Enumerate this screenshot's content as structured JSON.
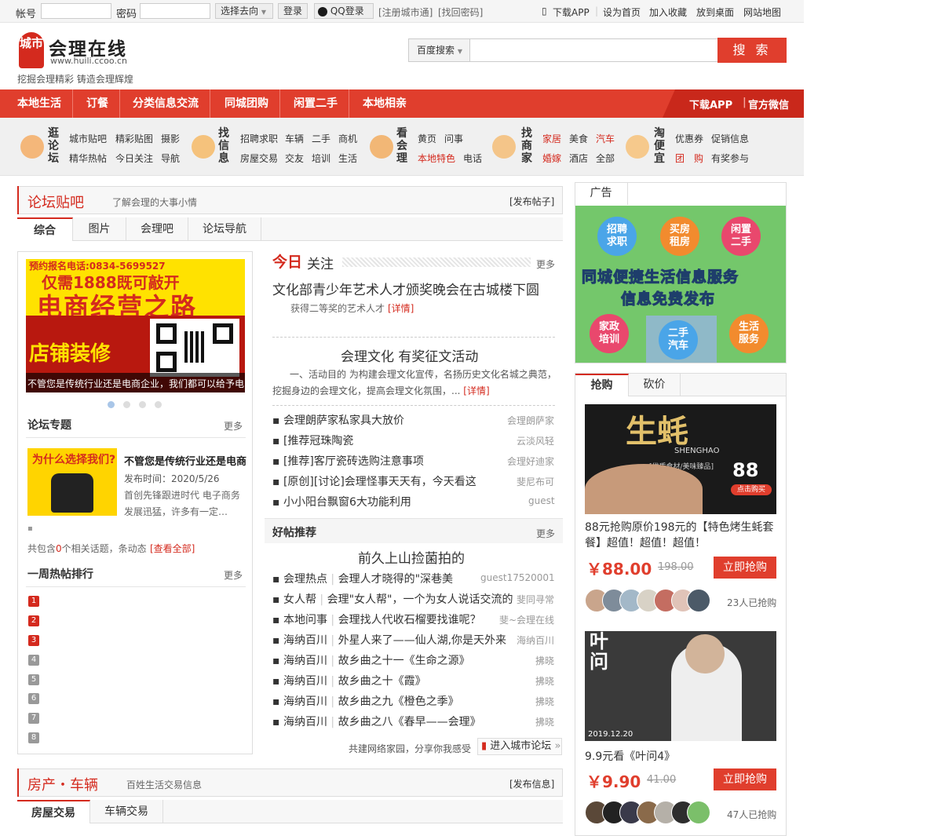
{
  "topbar": {
    "account_label": "帐号",
    "password_label": "密码",
    "select_label": "选择去向",
    "login_label": "登录",
    "qq_label": "QQ登录",
    "register_link": "[注册城市通]",
    "findpwd_link": "[找回密码]",
    "download_app": "下载APP",
    "set_home": "设为首页",
    "add_fav": "加入收藏",
    "to_desktop": "放到桌面",
    "sitemap": "网站地图"
  },
  "header": {
    "logo_badge": "城市",
    "logo_name": "会理在线",
    "logo_url": "www.huili.ccoo.cn",
    "slogan": "挖掘会理精彩 铸造会理辉煌",
    "search_engine": "百度搜索",
    "search_button": "搜 索"
  },
  "nav": {
    "items": [
      "本地生活",
      "订餐",
      "分类信息交流",
      "同城团购",
      "闲置二手",
      "本地相亲"
    ],
    "download_app": "下载APP",
    "wechat": "官方微信"
  },
  "categories": [
    {
      "title": "逛论坛",
      "links": [
        "城市贴吧",
        "精彩贴图",
        "摄影",
        "精华热帖",
        "今日关注",
        "导航"
      ]
    },
    {
      "title": "找信息",
      "links": [
        "招聘求职",
        "车辆",
        "二手",
        "商机",
        "房屋交易",
        "交友",
        "培训",
        "生活"
      ]
    },
    {
      "title": "看会理",
      "links": [
        "黄页",
        "问事",
        "本地特色",
        "电话"
      ]
    },
    {
      "title": "找商家",
      "links": [
        "家居",
        "美食",
        "汽车",
        "婚嫁",
        "酒店",
        "全部"
      ]
    },
    {
      "title": "淘便宜",
      "links": [
        "优惠券",
        "促销信息",
        "团",
        "购",
        "有奖参与"
      ]
    }
  ],
  "forum": {
    "title": "论坛贴吧",
    "subtitle": "了解会理的大事小情",
    "post_link": "[发布帖子]",
    "tabs": [
      "综合",
      "图片",
      "会理吧",
      "论坛导航"
    ],
    "banner": {
      "phone": "预约报名电话:0834-5699527",
      "line1": "仅需1888既可敲开",
      "line2": "电商经营之路",
      "shop": "店铺装修",
      "caption": "不管您是传统行业还是电商企业，我们都可以给予电"
    },
    "topics_title": "论坛专题",
    "more": "更多",
    "topic": {
      "thumb_text": "为什么选择我们?",
      "title": "不管您是传统行业还是电商",
      "date": "发布时间：2020/5/26",
      "desc": "首创先锋跟进时代 电子商务发展迅猛，许多有一定…"
    },
    "related": "共包含0个相关话题，条动态",
    "related_prefix": "共包含",
    "related_count": "0",
    "related_suffix": "个相关话题，条动态",
    "view_all": "[查看全部]",
    "weekly_title": "一周热帖排行",
    "ranks": [
      "1",
      "2",
      "3",
      "4",
      "5",
      "6",
      "7",
      "8"
    ],
    "today_label_1": "今日",
    "today_label_2": "关注",
    "headline": "文化部青少年艺术人才颁奖晚会在古城楼下圆",
    "headline_sub": "获得二等奖的艺术人才",
    "detail": "[详情]",
    "article_title": "会理文化 有奖征文活动",
    "article_body": "一、活动目的 为构建会理文化宣传，名扬历史文化名城之典范，挖掘身边的会理文化，提高会理文化氛围，...",
    "posts": [
      {
        "title": "会理朗萨家私家具大放价",
        "author": "会理朗萨家"
      },
      {
        "title": "[推荐冠珠陶瓷",
        "author": "云淡风轻"
      },
      {
        "title": "[推荐]客厅瓷砖选购注意事项",
        "author": "会理好迪家"
      },
      {
        "title": "[原创][讨论]会理怪事天天有，今天看这",
        "author": "斐尼布可"
      },
      {
        "title": "小小阳台飘窗6大功能利用",
        "author": "guest"
      }
    ],
    "good_title": "好帖推荐",
    "good_headline": "前久上山捡菌拍的",
    "good_posts": [
      {
        "board": "会理热点",
        "title": "会理人才晓得的\"深巷美",
        "author": "guest17520001"
      },
      {
        "board": "女人帮",
        "title": "会理\"女人帮\"，一个为女人说话交流的",
        "author": "斐同寻常"
      },
      {
        "board": "本地问事",
        "title": "会理找人代收石榴要找谁呢？",
        "author": "斐~会理在线"
      },
      {
        "board": "海纳百川",
        "title": "外星人来了——仙人湖,你是天外来",
        "author": "海纳百川"
      },
      {
        "board": "海纳百川",
        "title": "故乡曲之十一《生命之源》",
        "author": "拂晓"
      },
      {
        "board": "海纳百川",
        "title": "故乡曲之十《霞》",
        "author": "拂晓"
      },
      {
        "board": "海纳百川",
        "title": "故乡曲之九《橙色之季》",
        "author": "拂晓"
      },
      {
        "board": "海纳百川",
        "title": "故乡曲之八《春早——会理》",
        "author": "拂晓"
      }
    ],
    "footer_text": "共建网络家园，分享你我感受",
    "enter_forum": "进入城市论坛"
  },
  "house": {
    "title": "房产・车辆",
    "subtitle": "百姓生活交易信息",
    "post_link": "[发布信息]",
    "tabs": [
      "房屋交易",
      "车辆交易"
    ]
  },
  "ad": {
    "title": "广告",
    "bubbles": [
      "招聘求职",
      "买房租房",
      "闲置二手",
      "家政培训",
      "二手汽车",
      "生活服务"
    ],
    "line1": "同城便捷生活信息服务",
    "line2": "信息免费发布"
  },
  "deals": {
    "tabs": [
      "抢购",
      "砍价"
    ],
    "items": [
      {
        "img_text": "生蚝",
        "img_sub": "SHENGHAO",
        "img_tag": "[优质食材/美味臻品]",
        "img_price": "88",
        "img_buy": "点击购买",
        "title": "88元抢购原价198元的【特色烤生蚝套餐】超值！超值！超值！",
        "price": "￥88.00",
        "old": "198.00",
        "buy": "立即抢购",
        "count": "23人已抢购"
      },
      {
        "img_text": "叶问",
        "img_date": "2019.12.20",
        "title": "9.9元看《叶问4》",
        "price": "￥9.90",
        "old": "41.00",
        "buy": "立即抢购",
        "count": "47人已抢购"
      }
    ]
  }
}
